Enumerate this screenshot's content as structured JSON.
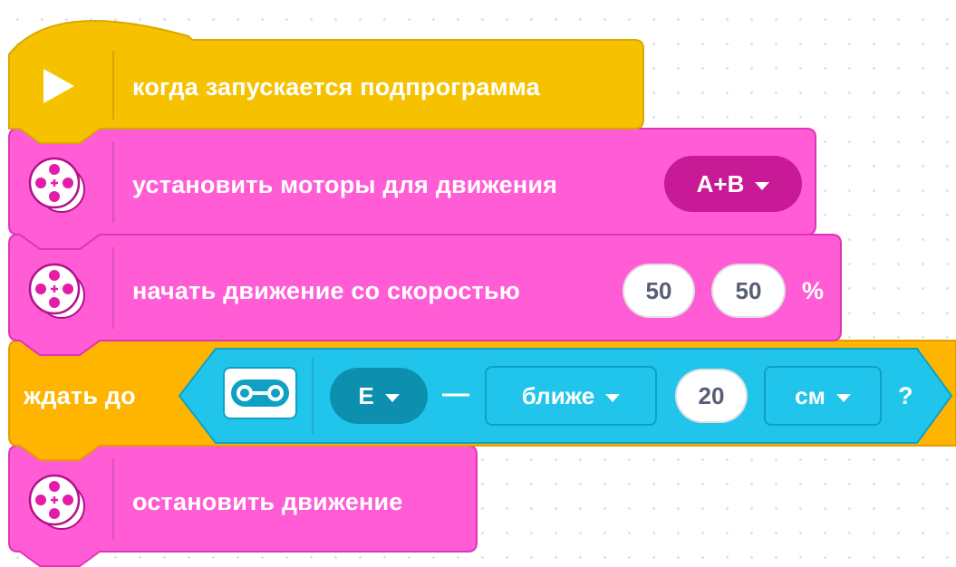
{
  "colors": {
    "event": "#f6c200",
    "motor": "#ff5cd6",
    "control": "#ffb400",
    "sensor": "#21c5eb",
    "motor_dropdown": "#c81a97",
    "port_dropdown": "#0d8fb0",
    "input_text": "#575e75"
  },
  "blocks": {
    "hat": {
      "icon": "play-triangle-icon",
      "label": "когда запускается подпрограмма"
    },
    "set_motors": {
      "icon": "motor-pair-icon",
      "label": "установить моторы для движения",
      "ports": "A+B"
    },
    "start_moving": {
      "icon": "motor-pair-icon",
      "label": "начать движение со скоростью",
      "speed_left": "50",
      "speed_right": "50",
      "unit": "%"
    },
    "wait_until": {
      "label": "ждать до",
      "sensor_icon": "distance-sensor-icon",
      "port": "E",
      "dash": "—",
      "comparison": "ближе",
      "distance": "20",
      "unit": "см",
      "question": "?"
    },
    "stop_moving": {
      "icon": "motor-pair-icon",
      "label": "остановить движение"
    }
  }
}
